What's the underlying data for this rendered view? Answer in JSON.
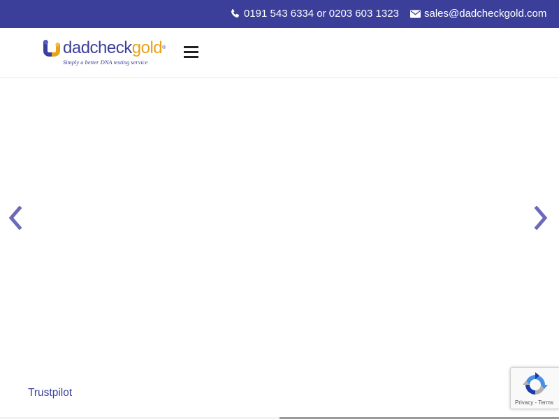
{
  "topbar": {
    "phone_icon": "phone-icon",
    "phone_text": "0191 543 6334 or 0203 603 1323",
    "email_icon": "envelope-icon",
    "email_text": "sales@dadcheckgold.com",
    "background_color": "#3b3f9a"
  },
  "header": {
    "logo": {
      "text_dad": "dadcheck",
      "text_gold": "gold",
      "registered": "®",
      "tagline": "Simply a better DNA testing service"
    },
    "menu_icon": "hamburger-menu-icon"
  },
  "slider": {
    "prev_icon": "chevron-left-icon",
    "next_icon": "chevron-right-icon",
    "arrow_color": "#6c6ab8"
  },
  "footer_link": {
    "trustpilot": "Trustpilot"
  },
  "recaptcha": {
    "icon": "recaptcha-icon",
    "privacy": "Privacy",
    "separator": " - ",
    "terms": "Terms"
  },
  "colors": {
    "brand_primary": "#3b3f9a",
    "brand_gold": "#e8a317"
  }
}
